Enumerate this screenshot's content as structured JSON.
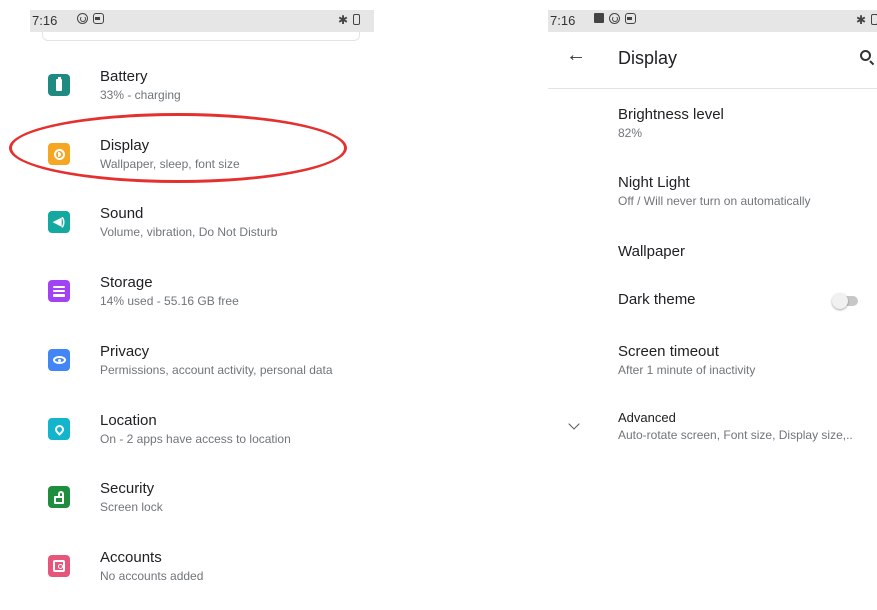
{
  "left_screen": {
    "status_bar": {
      "time": "7:16",
      "icons": [
        "cast-icon",
        "screenshot-icon",
        "bluetooth-icon",
        "battery-icon"
      ]
    },
    "items": [
      {
        "title": "Battery",
        "subtitle": "33% - charging",
        "icon": "battery-icon",
        "icon_color": "#1e8a82"
      },
      {
        "title": "Display",
        "subtitle": "Wallpaper, sleep, font size",
        "icon": "display-icon",
        "icon_color": "#f5a623"
      },
      {
        "title": "Sound",
        "subtitle": "Volume, vibration, Do Not Disturb",
        "icon": "sound-icon",
        "icon_color": "#14a9a0"
      },
      {
        "title": "Storage",
        "subtitle": "14% used - 55.16 GB free",
        "icon": "storage-icon",
        "icon_color": "#a142f4"
      },
      {
        "title": "Privacy",
        "subtitle": "Permissions, account activity, personal data",
        "icon": "privacy-icon",
        "icon_color": "#4285f4"
      },
      {
        "title": "Location",
        "subtitle": "On - 2 apps have access to location",
        "icon": "location-icon",
        "icon_color": "#12b5cb"
      },
      {
        "title": "Security",
        "subtitle": "Screen lock",
        "icon": "security-icon",
        "icon_color": "#1e8e3e"
      },
      {
        "title": "Accounts",
        "subtitle": "No accounts added",
        "icon": "accounts-icon",
        "icon_color": "#e8557a"
      }
    ],
    "highlight_color": "#e53030"
  },
  "right_screen": {
    "status_bar": {
      "time": "7:16",
      "icons": [
        "image-icon",
        "cast-icon",
        "screenshot-icon",
        "bluetooth-icon",
        "battery-icon"
      ]
    },
    "app_bar": {
      "title": "Display",
      "back_icon": "back-arrow-icon",
      "action_icon": "search-icon"
    },
    "items": [
      {
        "title": "Brightness level",
        "subtitle": "82%"
      },
      {
        "title": "Night Light",
        "subtitle": "Off / Will never turn on automatically"
      },
      {
        "title": "Wallpaper"
      },
      {
        "title": "Dark theme",
        "toggle": false
      },
      {
        "title": "Screen timeout",
        "subtitle": "After 1 minute of inactivity"
      },
      {
        "title": "Advanced",
        "subtitle": "Auto-rotate screen, Font size, Display size,..",
        "icon": "chevron-down-icon"
      }
    ]
  }
}
